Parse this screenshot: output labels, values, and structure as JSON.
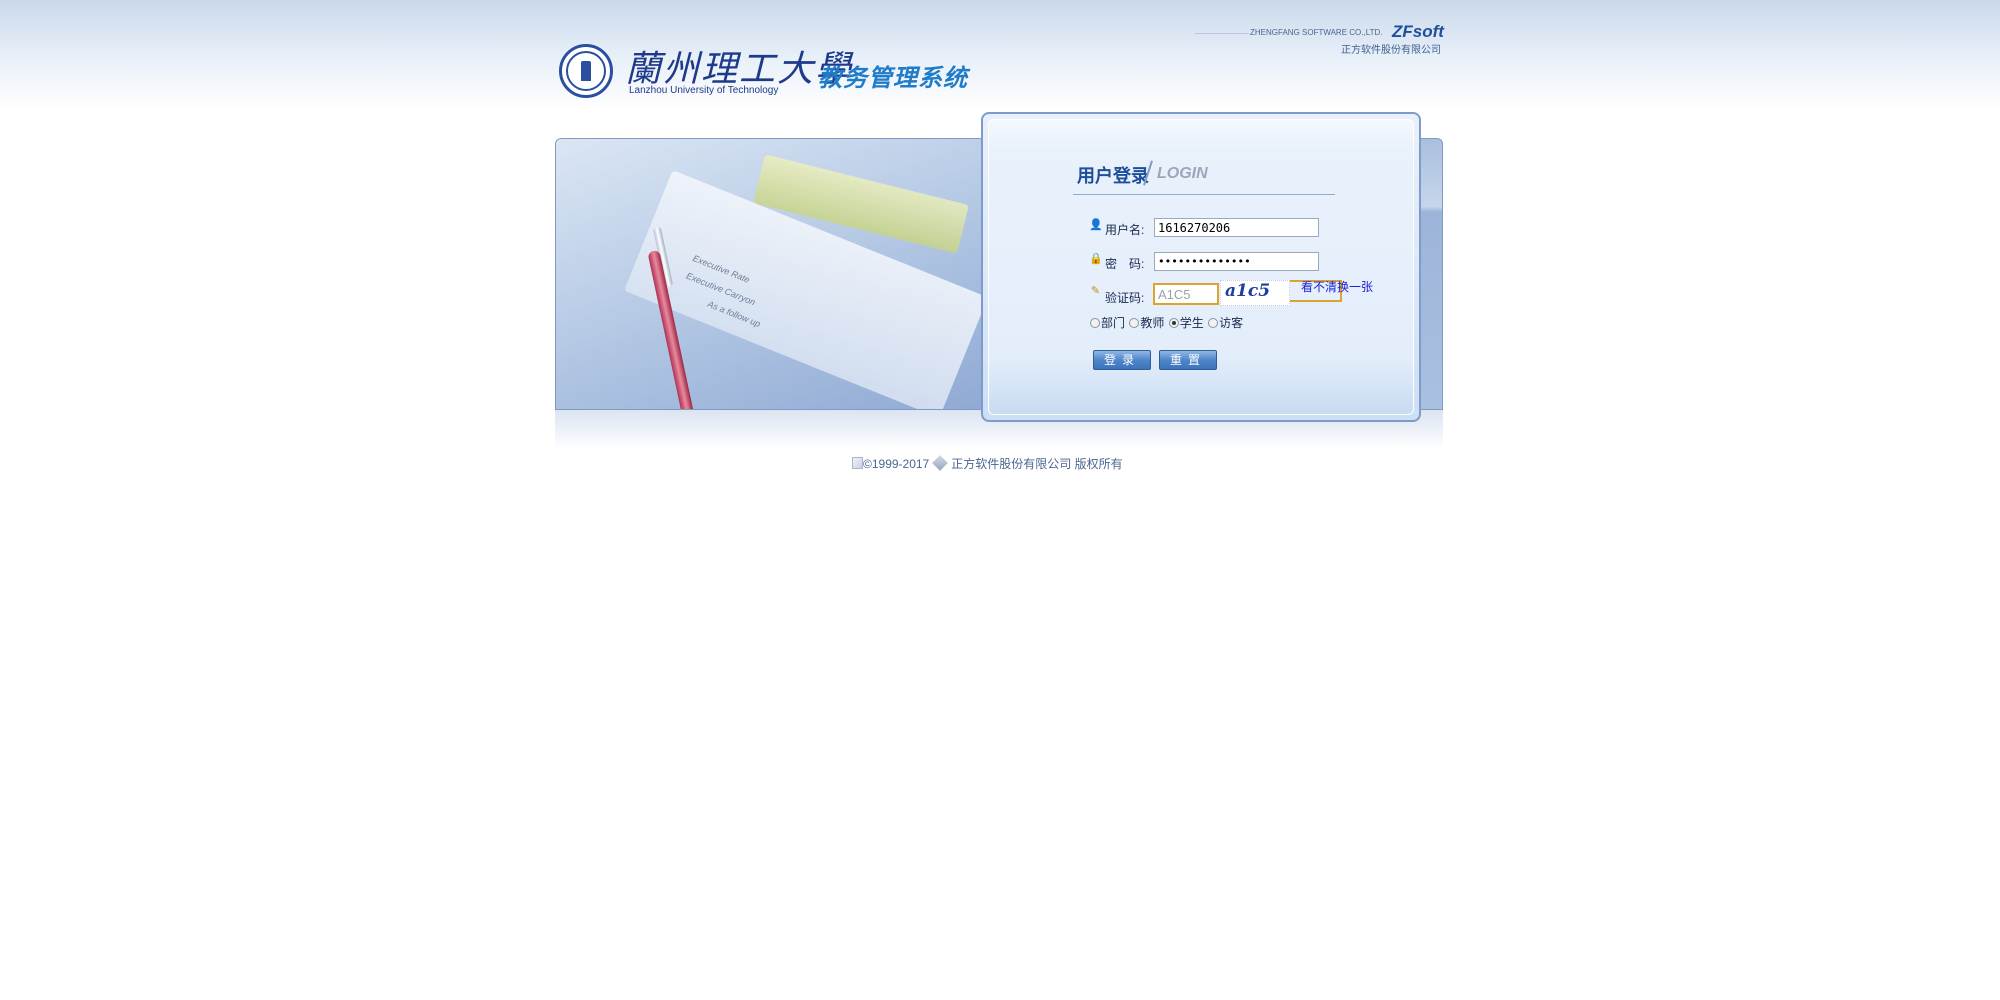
{
  "header": {
    "university_cn": "蘭州理工大學",
    "university_en": "Lanzhou University of Technology",
    "system_name": "教务管理系统",
    "vendor_en": "ZHENGFANG SOFTWARE CO.,LTD.",
    "vendor_brand": "ZFsoft",
    "vendor_cn": "正方软件股份有限公司"
  },
  "banner": {
    "paper_lines": [
      "Executive Rate",
      "Executive Carryon",
      "As a follow up"
    ]
  },
  "login": {
    "title": "用户登录",
    "title_en": "LOGIN",
    "username_label": "用户名:",
    "username_value": "1616270206",
    "password_label": "密　码:",
    "password_value": "••••••••••••••",
    "captcha_label": "验证码:",
    "captcha_value": "A1C5",
    "captcha_image_text": "a1c5",
    "refresh_link": "看不清换一张",
    "roles": [
      {
        "label": "部门",
        "selected": false
      },
      {
        "label": "教师",
        "selected": false
      },
      {
        "label": "学生",
        "selected": true
      },
      {
        "label": "访客",
        "selected": false
      }
    ],
    "login_button": "登录",
    "reset_button": "重置"
  },
  "footer": {
    "copyright": "©1999-2017",
    "company": "正方软件股份有限公司 版权所有"
  },
  "colors": {
    "accent": "#1f7cc9",
    "title_blue": "#1d4f9d",
    "link": "#1b22d8",
    "captcha_border": "#d9a52e"
  },
  "icons": {
    "user": "user-icon",
    "password": "lock-icon",
    "captcha": "pencil-icon",
    "footer": "zfsoft-cube-icon"
  }
}
